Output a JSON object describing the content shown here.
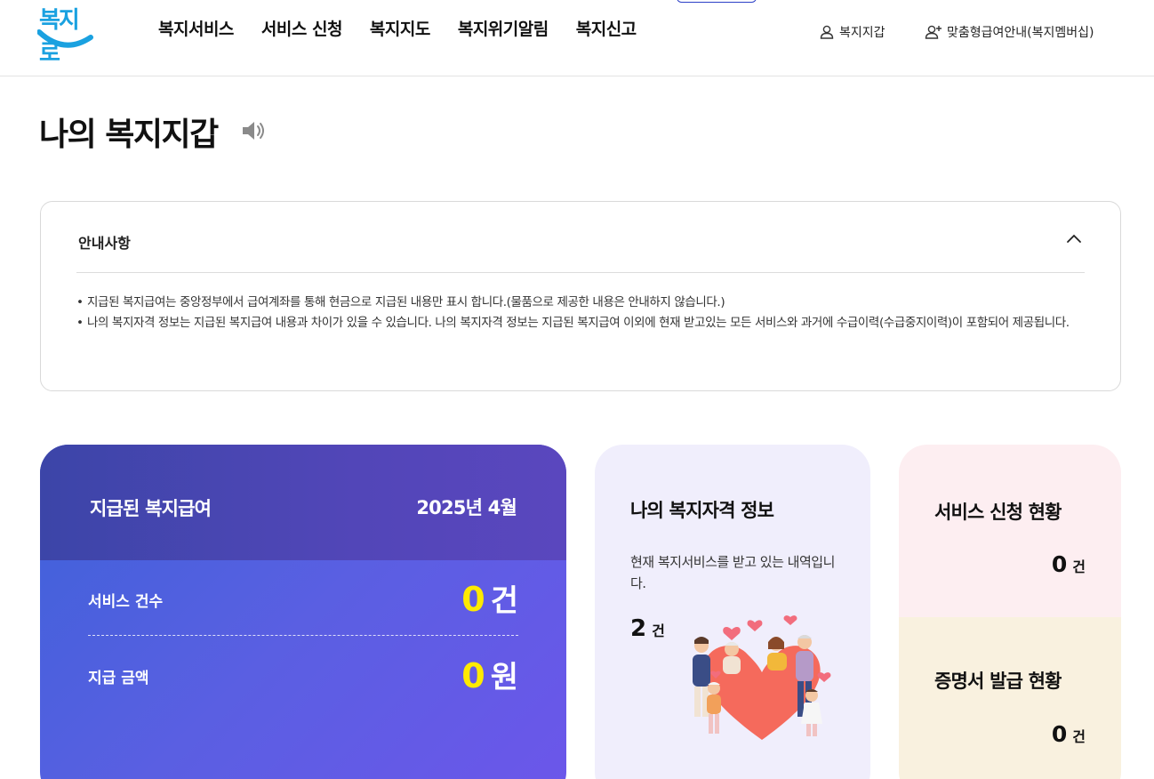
{
  "header": {
    "logo_text": "복지로",
    "nav": [
      "복지서비스",
      "서비스 신청",
      "복지지도",
      "복지위기알림",
      "복지신고"
    ],
    "util_wallet": "복지지갑",
    "util_member": "맞춤형급여안내(복지멤버십)"
  },
  "page": {
    "title": "나의 복지지갑"
  },
  "notice": {
    "title": "안내사항",
    "items": [
      "지급된 복지급여는 중앙정부에서 급여계좌를 통해 현금으로 지급된 내용만 표시 합니다.(물품으로 제공한 내용은 안내하지 않습니다.)",
      "나의 복지자격 정보는 지급된 복지급여 내용과 차이가 있을 수 있습니다. 나의 복지자격 정보는 지급된 복지급여 이외에 현재 받고있는 모든 서비스와 과거에 수급이력(수급중지이력)이 포함되어 제공됩니다."
    ]
  },
  "payment_card": {
    "title": "지급된 복지급여",
    "date": "2025년  4월",
    "service_count_label": "서비스 건수",
    "service_count": "0",
    "service_count_unit": "건",
    "amount_label": "지급 금액",
    "amount": "0",
    "amount_unit": "원"
  },
  "qualification_card": {
    "title": "나의 복지자격 정보",
    "description": "현재 복지서비스를 받고 있는 내역입니다.",
    "count": "2",
    "unit": "건"
  },
  "status_card": {
    "application_title": "서비스 신청 현황",
    "application_count": "0",
    "application_unit": "건",
    "certificate_title": "증명서 발급 현황",
    "certificate_count": "0",
    "certificate_unit": "건"
  },
  "colors": {
    "logo": "#1aa1e0",
    "accent_yellow": "#ffea00",
    "payment_gradient_start": "#3d62d9",
    "payment_gradient_end": "#6c56ea",
    "qual_bg": "#f0eefc",
    "application_bg": "#fdeef1",
    "certificate_bg": "#f9f1df"
  },
  "icons": {
    "speaker": "speaker-icon",
    "person": "person-icon",
    "person_add": "person-add-icon",
    "chevron_up": "chevron-up-icon"
  }
}
